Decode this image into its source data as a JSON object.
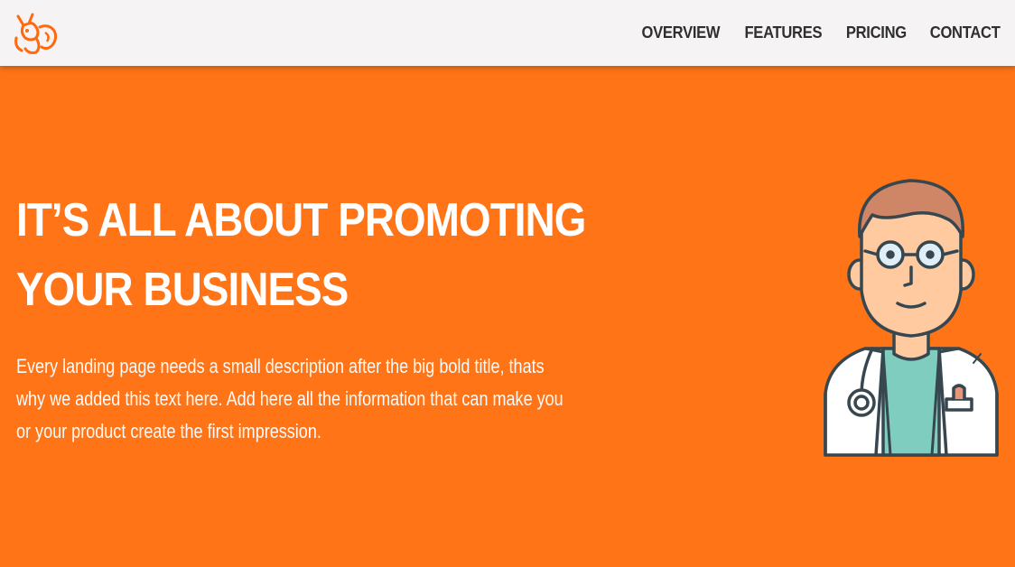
{
  "navbar": {
    "logo_icon": "fox-logo-icon",
    "brand_color": "#ff7417",
    "links": [
      {
        "label": "OVERVIEW"
      },
      {
        "label": "FEATURES"
      },
      {
        "label": "PRICING"
      },
      {
        "label": "CONTACT"
      }
    ]
  },
  "hero": {
    "background": "#ff7417",
    "title_line1": "IT’S ALL ABOUT PROMOTING",
    "title_line2": "YOUR BUSINESS",
    "description": "Every landing page needs a small description after the big bold title, thats why we added this text here. Add here all the information that can make you or your product create the first impression.",
    "illustration_icon": "doctor-illustration"
  }
}
